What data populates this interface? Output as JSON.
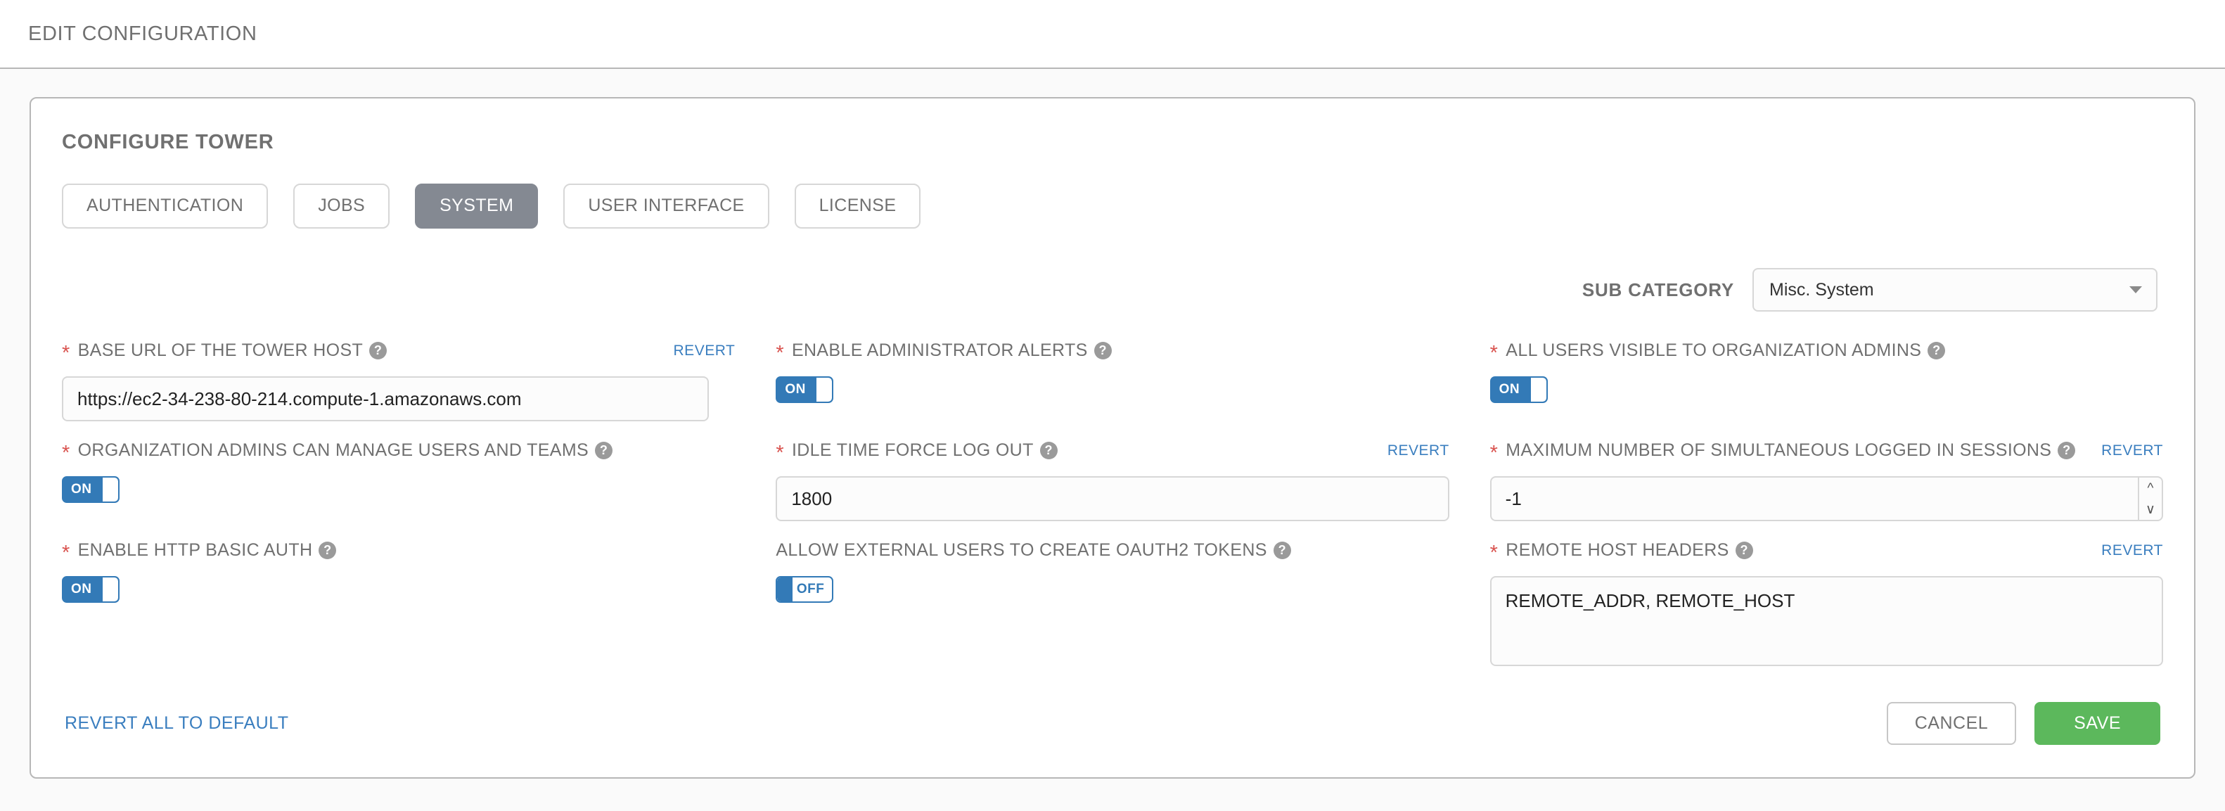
{
  "breadcrumb": {
    "title": "EDIT CONFIGURATION"
  },
  "card": {
    "title": "CONFIGURE TOWER"
  },
  "tabs": [
    {
      "label": "AUTHENTICATION",
      "active": false
    },
    {
      "label": "JOBS",
      "active": false
    },
    {
      "label": "SYSTEM",
      "active": true
    },
    {
      "label": "USER INTERFACE",
      "active": false
    },
    {
      "label": "LICENSE",
      "active": false
    }
  ],
  "sub_category": {
    "label": "SUB CATEGORY",
    "selected": "Misc. System",
    "caret_icon": "chevron-down-icon"
  },
  "help_icon_glyph": "?",
  "required_marker": "*",
  "fields": {
    "base_url": {
      "label": "BASE URL OF THE TOWER HOST",
      "required": true,
      "revert": "REVERT",
      "value": "https://ec2-34-238-80-214.compute-1.amazonaws.com"
    },
    "admin_alerts": {
      "label": "ENABLE ADMINISTRATOR ALERTS",
      "required": true,
      "toggle_state": "ON"
    },
    "all_users_visible": {
      "label": "ALL USERS VISIBLE TO ORGANIZATION ADMINS",
      "required": true,
      "toggle_state": "ON"
    },
    "org_admins_manage": {
      "label": "ORGANIZATION ADMINS CAN MANAGE USERS AND TEAMS",
      "required": true,
      "toggle_state": "ON"
    },
    "idle_time": {
      "label": "IDLE TIME FORCE LOG OUT",
      "required": true,
      "revert": "REVERT",
      "value": "1800"
    },
    "max_sessions": {
      "label": "MAXIMUM NUMBER OF SIMULTANEOUS LOGGED IN SESSIONS",
      "required": true,
      "revert": "REVERT",
      "value": "-1"
    },
    "http_basic_auth": {
      "label": "ENABLE HTTP BASIC AUTH",
      "required": true,
      "toggle_state": "ON"
    },
    "oauth2_tokens": {
      "label": "ALLOW EXTERNAL USERS TO CREATE OAUTH2 TOKENS",
      "required": false,
      "toggle_state": "OFF"
    },
    "remote_host_headers": {
      "label": "REMOTE HOST HEADERS",
      "required": true,
      "revert": "REVERT",
      "value": "REMOTE_ADDR, REMOTE_HOST"
    }
  },
  "footer": {
    "revert_all": "REVERT ALL TO DEFAULT",
    "cancel": "CANCEL",
    "save": "SAVE"
  },
  "colors": {
    "accent_blue": "#337ab7",
    "link_blue": "#3a7ebf",
    "save_green": "#5cb85c",
    "active_tab_gray": "#848992",
    "required_red": "#d9534f",
    "label_gray": "#707070"
  }
}
